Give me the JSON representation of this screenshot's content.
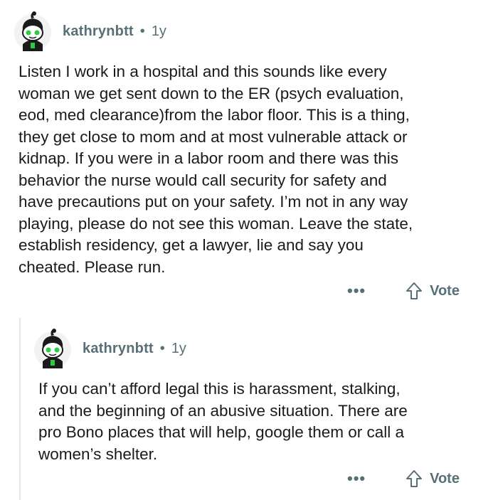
{
  "comments": [
    {
      "author": "kathrynbtt",
      "separator": "•",
      "age": "1y",
      "text": "Listen I work in a hospital and this sounds like every\nwoman we get sent down to the ER (psych evaluation,\neod, med clearance)from the labor floor. This is a thing,\nthey get close to mom and at most vulnerable attack or\nkidnap. If you were in a labor room and there was this\nbehavior the nurse would call security for safety and\nhave precautions put on your safety. I’m not in any way\nplaying, please do not see this woman. Leave the state,\nestablish residency, get a lawyer, lie and say you\ncheated. Please run.",
      "more_label": "•••",
      "vote_label": "Vote"
    },
    {
      "author": "kathrynbtt",
      "separator": "•",
      "age": "1y",
      "text": "If you can’t afford legal this is harassment, stalking,\nand the beginning of an abusive situation. There are\npro Bono places that will help, google them or call a\nwomen’s shelter.",
      "more_label": "•••",
      "vote_label": "Vote"
    }
  ],
  "icons": {
    "avatar": "snoo-avatar-icon",
    "more": "more-options-icon",
    "upvote": "upvote-arrow-icon"
  },
  "colors": {
    "meta": "#576f76",
    "text": "#1a1a1b",
    "avatar_accent": "#2ecc40",
    "thread_line": "#e5e7e8"
  }
}
